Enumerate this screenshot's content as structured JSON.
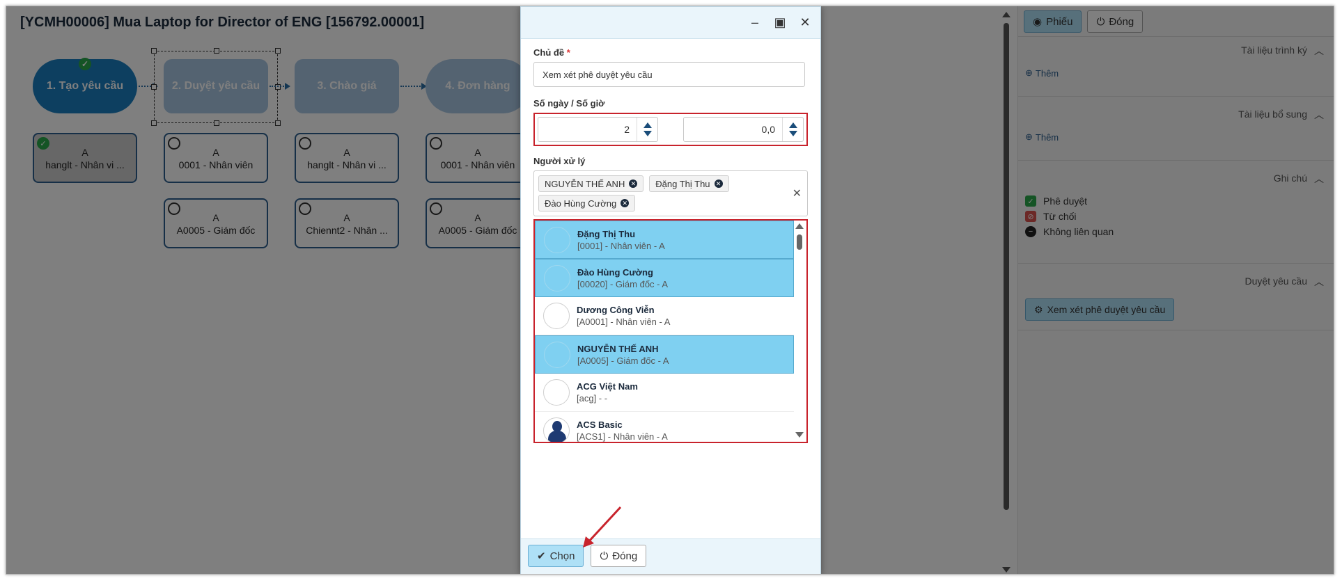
{
  "page": {
    "title": "[YCMH00006] Mua Laptop for Director of ENG [156792.00001]"
  },
  "flow": {
    "steps": [
      {
        "label": "1. Tạo yêu cầu",
        "state": "active"
      },
      {
        "label": "2. Duyệt yêu cầu",
        "state": "pending"
      },
      {
        "label": "3. Chào giá",
        "state": "pending"
      },
      {
        "label": "4. Đơn hàng",
        "state": "pending"
      }
    ],
    "cards": [
      {
        "top": "A",
        "bottom": "hanglt - Nhân vi ...",
        "done": true
      },
      {
        "top": "A",
        "bottom": "0001 - Nhân viên",
        "done": false
      },
      {
        "top": "A",
        "bottom": "hanglt - Nhân vi ...",
        "done": false
      },
      {
        "top": "A",
        "bottom": "0001 - Nhân viên",
        "done": false
      },
      {
        "top": "A",
        "bottom": "A0005 - Giám đốc",
        "done": false
      },
      {
        "top": "A",
        "bottom": "Chiennt2 - Nhân ...",
        "done": false
      },
      {
        "top": "A",
        "bottom": "A0005 - Giám đốc",
        "done": false
      }
    ]
  },
  "right_panel": {
    "toolbar": {
      "form_label": "Phiếu",
      "close_label": "Đóng"
    },
    "sections": {
      "sign_docs": {
        "title": "Tài liệu trình ký",
        "add_label": "Thêm"
      },
      "extra_docs": {
        "title": "Tài liệu bổ sung",
        "add_label": "Thêm"
      },
      "notes": {
        "title": "Ghi chú",
        "legend": [
          {
            "label": "Phê duyệt",
            "color": "#2aa84a"
          },
          {
            "label": "Từ chối",
            "color": "#d9534f"
          },
          {
            "label": "Không liên quan",
            "color": "#222222"
          }
        ]
      },
      "review": {
        "title": "Duyệt yêu cầu",
        "action_label": "Xem xét phê duyệt yêu cầu"
      }
    }
  },
  "dialog": {
    "subject_label": "Chủ đề",
    "required_mark": "*",
    "subject_value": "Xem xét phê duyệt yêu cầu",
    "duration_label": "Số ngày / Số giờ",
    "days_value": "2",
    "hours_value": "0,0",
    "assignee_label": "Người xử lý",
    "tags": [
      "NGUYỄN THẾ ANH",
      "Đặng Thị Thu",
      "Đào Hùng Cường"
    ],
    "options": [
      {
        "name": "Đặng Thị Thu",
        "sub": "[0001] - Nhân viên - A",
        "selected": true
      },
      {
        "name": "Đào Hùng Cường",
        "sub": "[00020] - Giám đốc - A",
        "selected": true
      },
      {
        "name": "Dương Công Viễn",
        "sub": "[A0001] - Nhân viên - A",
        "selected": false
      },
      {
        "name": "NGUYỄN THẾ ANH",
        "sub": "[A0005] - Giám đốc - A",
        "selected": true
      },
      {
        "name": "ACG Việt Nam",
        "sub": "[acg] - -",
        "selected": false
      },
      {
        "name": "ACS Basic",
        "sub": "[ACS1] - Nhân viên - A",
        "selected": false
      }
    ],
    "footer": {
      "choose_label": "Chọn",
      "close_label": "Đóng"
    }
  },
  "colors": {
    "accent": "#1a7fc1",
    "selected_row": "#7fd0f1",
    "highlight_border": "#c8232c",
    "overlay": "rgba(0,0,0,0.50)"
  }
}
